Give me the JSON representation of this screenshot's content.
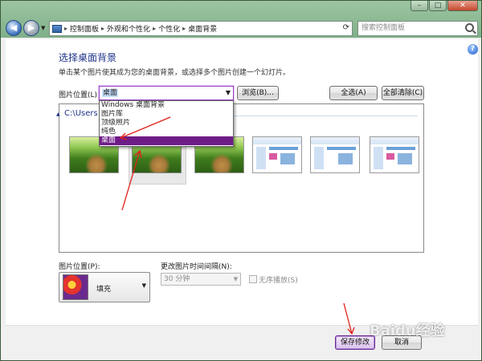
{
  "window": {
    "controls": {
      "minimize": "–",
      "maximize": "□",
      "close": "✕"
    }
  },
  "nav": {
    "back_icon": "back-arrow-icon",
    "forward_icon": "forward-arrow-icon",
    "breadcrumbs": [
      "控制面板",
      "外观和个性化",
      "个性化",
      "桌面背景"
    ],
    "search_placeholder": "搜索控制面板"
  },
  "page": {
    "title": "选择桌面背景",
    "description": "单击某个图片使其成为您的桌面背景，或选择多个图片创建一个幻灯片。"
  },
  "location": {
    "label": "图片位置(L):",
    "selected": "桌面",
    "options": [
      "Windows 桌面背景",
      "图片库",
      "顶级照片",
      "纯色",
      "桌面"
    ],
    "browse_label": "浏览(B)...",
    "select_all_label": "全选(A)",
    "clear_all_label": "全部清除(C)"
  },
  "gallery": {
    "group_header": "C:\\Users",
    "thumbnails": [
      {
        "kind": "photo"
      },
      {
        "kind": "photo",
        "selected": true
      },
      {
        "kind": "photo"
      },
      {
        "kind": "screenshot"
      },
      {
        "kind": "screenshot"
      },
      {
        "kind": "screenshot"
      },
      {
        "kind": "screenshot"
      }
    ]
  },
  "position": {
    "label": "图片位置(P):",
    "value": "填充"
  },
  "interval": {
    "label": "更改图片时间间隔(N):",
    "value": "30 分钟",
    "shuffle_label": "无序播放(S)"
  },
  "footer": {
    "save_label": "保存修改",
    "cancel_label": "取消"
  },
  "watermark": "Baidu经验",
  "colors": {
    "annotation_red": "#e0201a",
    "selection_purple": "#6e1b87",
    "title_blue": "#1e3287"
  }
}
